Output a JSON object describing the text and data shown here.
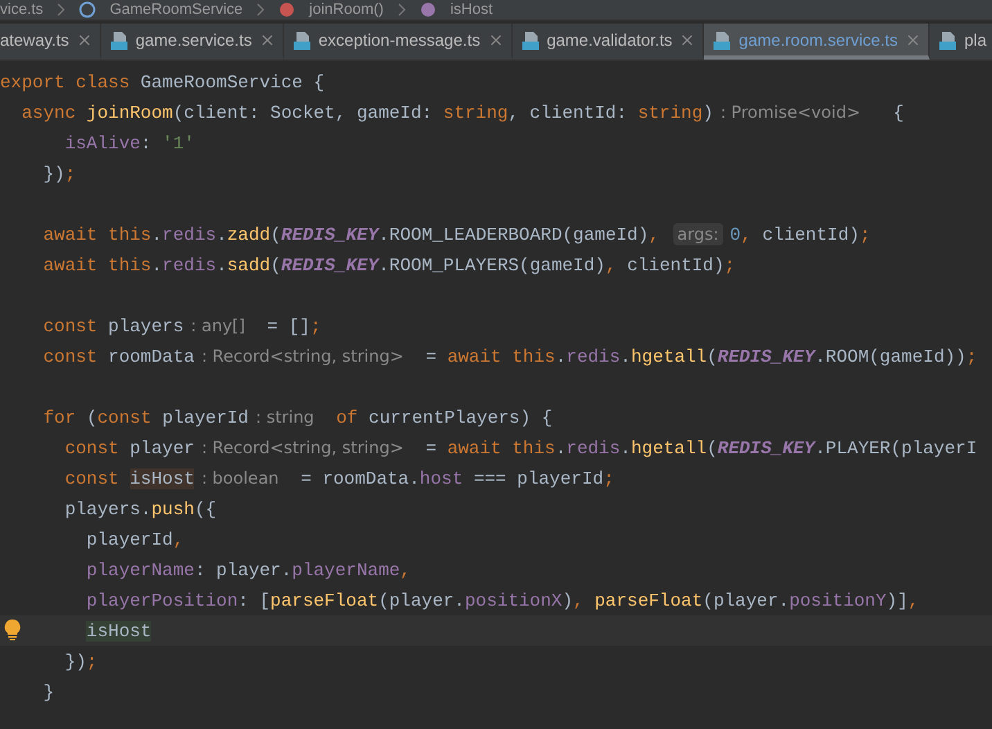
{
  "breadcrumb": [
    {
      "label": "vice.ts",
      "kind": "file"
    },
    {
      "label": "GameRoomService",
      "kind": "class"
    },
    {
      "label": "joinRoom()",
      "kind": "method"
    },
    {
      "label": "isHost",
      "kind": "field"
    }
  ],
  "tabs": [
    {
      "label": "ateway.ts",
      "selected": false
    },
    {
      "label": "game.service.ts",
      "selected": false
    },
    {
      "label": "exception-message.ts",
      "selected": false
    },
    {
      "label": "game.validator.ts",
      "selected": false
    },
    {
      "label": "game.room.service.ts",
      "selected": true
    },
    {
      "label": "pla",
      "selected": false
    }
  ],
  "editor": {
    "lines": [
      {
        "kind": "code",
        "current": false,
        "tokens": [
          {
            "kind": "kw",
            "text": "export class "
          },
          {
            "kind": "plain",
            "text": "GameRoomService {"
          }
        ]
      },
      {
        "kind": "code",
        "current": false,
        "tokens": [
          {
            "kind": "kw",
            "text": "  async "
          },
          {
            "kind": "fn",
            "text": "joinRoom"
          },
          {
            "kind": "plain",
            "text": "(client: Socket, gameId: "
          },
          {
            "kind": "kw",
            "text": "string"
          },
          {
            "kind": "plain",
            "text": ", clientId: "
          },
          {
            "kind": "kw",
            "text": "string"
          },
          {
            "kind": "plain",
            "text": ")"
          },
          {
            "kind": "hint",
            "text": ": Promise<void>"
          },
          {
            "kind": "plain",
            "text": "  {"
          }
        ]
      },
      {
        "kind": "code",
        "current": false,
        "tokens": [
          {
            "kind": "prop",
            "text": "      isAlive"
          },
          {
            "kind": "plain",
            "text": ": "
          },
          {
            "kind": "str",
            "text": "'1'"
          }
        ]
      },
      {
        "kind": "code",
        "current": false,
        "tokens": [
          {
            "kind": "plain",
            "text": "    })"
          },
          {
            "kind": "punct",
            "text": ";"
          }
        ]
      },
      {
        "kind": "blank",
        "current": false
      },
      {
        "kind": "code",
        "current": false,
        "tokens": [
          {
            "kind": "kw",
            "text": "    await this"
          },
          {
            "kind": "plain",
            "text": "."
          },
          {
            "kind": "prop",
            "text": "redis"
          },
          {
            "kind": "plain",
            "text": "."
          },
          {
            "kind": "fn",
            "text": "zadd"
          },
          {
            "kind": "plain",
            "text": "("
          },
          {
            "kind": "const",
            "text": "REDIS_KEY"
          },
          {
            "kind": "plain",
            "text": ".ROOM_LEADERBOARD(gameId)"
          },
          {
            "kind": "punct",
            "text": ", "
          },
          {
            "kind": "param",
            "text": "args:"
          },
          {
            "kind": "num",
            "text": "0"
          },
          {
            "kind": "punct",
            "text": ","
          },
          {
            "kind": "plain",
            "text": " clientId)"
          },
          {
            "kind": "punct",
            "text": ";"
          }
        ]
      },
      {
        "kind": "code",
        "current": false,
        "tokens": [
          {
            "kind": "kw",
            "text": "    await this"
          },
          {
            "kind": "plain",
            "text": "."
          },
          {
            "kind": "prop",
            "text": "redis"
          },
          {
            "kind": "plain",
            "text": "."
          },
          {
            "kind": "fn",
            "text": "sadd"
          },
          {
            "kind": "plain",
            "text": "("
          },
          {
            "kind": "const",
            "text": "REDIS_KEY"
          },
          {
            "kind": "plain",
            "text": ".ROOM_PLAYERS(gameId)"
          },
          {
            "kind": "punct",
            "text": ","
          },
          {
            "kind": "plain",
            "text": " clientId)"
          },
          {
            "kind": "punct",
            "text": ";"
          }
        ]
      },
      {
        "kind": "blank",
        "current": false
      },
      {
        "kind": "code",
        "current": false,
        "tokens": [
          {
            "kind": "kw",
            "text": "    const "
          },
          {
            "kind": "plain",
            "text": "players"
          },
          {
            "kind": "hint",
            "text": ": any[]"
          },
          {
            "kind": "plain",
            "text": " = []"
          },
          {
            "kind": "punct",
            "text": ";"
          }
        ]
      },
      {
        "kind": "code",
        "current": false,
        "tokens": [
          {
            "kind": "kw",
            "text": "    const "
          },
          {
            "kind": "plain",
            "text": "roomData"
          },
          {
            "kind": "hint",
            "text": ": Record<string, string>"
          },
          {
            "kind": "plain",
            "text": " = "
          },
          {
            "kind": "kw",
            "text": "await this"
          },
          {
            "kind": "plain",
            "text": "."
          },
          {
            "kind": "prop",
            "text": "redis"
          },
          {
            "kind": "plain",
            "text": "."
          },
          {
            "kind": "fn",
            "text": "hgetall"
          },
          {
            "kind": "plain",
            "text": "("
          },
          {
            "kind": "const",
            "text": "REDIS_KEY"
          },
          {
            "kind": "plain",
            "text": ".ROOM(gameId))"
          },
          {
            "kind": "punct",
            "text": ";"
          }
        ]
      },
      {
        "kind": "blank",
        "current": false
      },
      {
        "kind": "code",
        "current": false,
        "tokens": [
          {
            "kind": "kw",
            "text": "    for "
          },
          {
            "kind": "plain",
            "text": "("
          },
          {
            "kind": "kw",
            "text": "const "
          },
          {
            "kind": "plain",
            "text": "playerId"
          },
          {
            "kind": "hint",
            "text": ": string"
          },
          {
            "kind": "kw",
            "text": " of "
          },
          {
            "kind": "plain",
            "text": "currentPlayers) {"
          }
        ]
      },
      {
        "kind": "code",
        "current": false,
        "tokens": [
          {
            "kind": "kw",
            "text": "      const "
          },
          {
            "kind": "plain",
            "text": "player"
          },
          {
            "kind": "hint",
            "text": ": Record<string, string>"
          },
          {
            "kind": "plain",
            "text": " = "
          },
          {
            "kind": "kw",
            "text": "await this"
          },
          {
            "kind": "plain",
            "text": "."
          },
          {
            "kind": "prop",
            "text": "redis"
          },
          {
            "kind": "plain",
            "text": "."
          },
          {
            "kind": "fn",
            "text": "hgetall"
          },
          {
            "kind": "plain",
            "text": "("
          },
          {
            "kind": "const",
            "text": "REDIS_KEY"
          },
          {
            "kind": "plain",
            "text": ".PLAYER(playerI"
          }
        ]
      },
      {
        "kind": "code",
        "current": false,
        "tokens": [
          {
            "kind": "kw",
            "text": "      const "
          },
          {
            "kind": "write",
            "text": "isHost"
          },
          {
            "kind": "hint",
            "text": ": boolean"
          },
          {
            "kind": "plain",
            "text": " = roomData."
          },
          {
            "kind": "prop",
            "text": "host"
          },
          {
            "kind": "plain",
            "text": " === playerId"
          },
          {
            "kind": "punct",
            "text": ";"
          }
        ]
      },
      {
        "kind": "code",
        "current": false,
        "tokens": [
          {
            "kind": "plain",
            "text": "      players."
          },
          {
            "kind": "fn",
            "text": "push"
          },
          {
            "kind": "plain",
            "text": "({"
          }
        ]
      },
      {
        "kind": "code",
        "current": false,
        "tokens": [
          {
            "kind": "plain",
            "text": "        playerId"
          },
          {
            "kind": "punct",
            "text": ","
          }
        ]
      },
      {
        "kind": "code",
        "current": false,
        "tokens": [
          {
            "kind": "prop",
            "text": "        playerName"
          },
          {
            "kind": "plain",
            "text": ": player."
          },
          {
            "kind": "prop",
            "text": "playerName"
          },
          {
            "kind": "punct",
            "text": ","
          }
        ]
      },
      {
        "kind": "code",
        "current": false,
        "tokens": [
          {
            "kind": "prop",
            "text": "        playerPosition"
          },
          {
            "kind": "plain",
            "text": ": ["
          },
          {
            "kind": "fn",
            "text": "parseFloat"
          },
          {
            "kind": "plain",
            "text": "(player."
          },
          {
            "kind": "prop",
            "text": "positionX"
          },
          {
            "kind": "plain",
            "text": ")"
          },
          {
            "kind": "punct",
            "text": ", "
          },
          {
            "kind": "fn",
            "text": "parseFloat"
          },
          {
            "kind": "plain",
            "text": "(player."
          },
          {
            "kind": "prop",
            "text": "positionY"
          },
          {
            "kind": "plain",
            "text": ")]"
          },
          {
            "kind": "punct",
            "text": ","
          }
        ]
      },
      {
        "kind": "code",
        "current": true,
        "tokens": [
          {
            "kind": "read",
            "text": "        isHost"
          }
        ]
      },
      {
        "kind": "code",
        "current": false,
        "tokens": [
          {
            "kind": "plain",
            "text": "      })"
          },
          {
            "kind": "punct",
            "text": ";"
          }
        ]
      },
      {
        "kind": "code",
        "current": false,
        "tokens": [
          {
            "kind": "plain",
            "text": "    }"
          }
        ]
      }
    ]
  }
}
